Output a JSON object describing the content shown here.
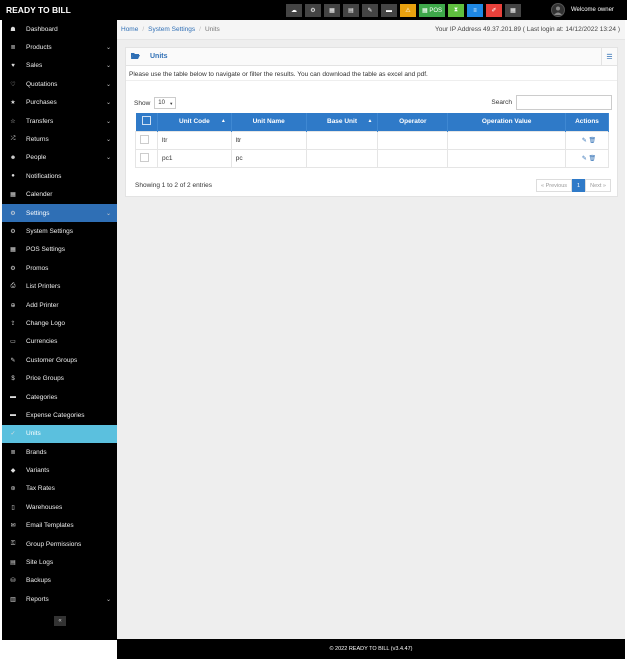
{
  "app": {
    "brand": "READY TO BILL"
  },
  "topbar": {
    "icons": [
      {
        "name": "dashboard-icon",
        "glyph": "☁",
        "style": ""
      },
      {
        "name": "settings-icon",
        "glyph": "⚙",
        "style": ""
      },
      {
        "name": "calculator-icon",
        "glyph": "▦",
        "style": ""
      },
      {
        "name": "calendar-icon",
        "glyph": "▤",
        "style": ""
      },
      {
        "name": "notes-icon",
        "glyph": "✎",
        "style": ""
      },
      {
        "name": "language-flag-icon",
        "glyph": "▬",
        "style": ""
      },
      {
        "name": "alert-icon",
        "glyph": "⚠",
        "style": "orange"
      },
      {
        "name": "pos-button",
        "glyph": "▦ POS",
        "style": "green"
      },
      {
        "name": "hourglass-icon",
        "glyph": "⧗",
        "style": "green2"
      },
      {
        "name": "list-icon",
        "glyph": "≡",
        "style": "blue"
      },
      {
        "name": "pen-icon",
        "glyph": "✐",
        "style": "red"
      },
      {
        "name": "grid-icon",
        "glyph": "▦",
        "style": ""
      }
    ],
    "welcome": "Welcome owner"
  },
  "sidebar": {
    "items": [
      {
        "label": "Dashboard",
        "icon": "☗",
        "name": "dashboard",
        "chev": false,
        "state": ""
      },
      {
        "label": "Products",
        "icon": "≣",
        "name": "products",
        "chev": true,
        "state": ""
      },
      {
        "label": "Sales",
        "icon": "♥",
        "name": "sales",
        "chev": true,
        "state": ""
      },
      {
        "label": "Quotations",
        "icon": "♡",
        "name": "quotations",
        "chev": true,
        "state": ""
      },
      {
        "label": "Purchases",
        "icon": "★",
        "name": "purchases",
        "chev": true,
        "state": ""
      },
      {
        "label": "Transfers",
        "icon": "☆",
        "name": "transfers",
        "chev": true,
        "state": ""
      },
      {
        "label": "Returns",
        "icon": "⤮",
        "name": "returns",
        "chev": true,
        "state": ""
      },
      {
        "label": "People",
        "icon": "☻",
        "name": "people",
        "chev": true,
        "state": ""
      },
      {
        "label": "Notifications",
        "icon": "●",
        "name": "notifications",
        "chev": false,
        "state": ""
      },
      {
        "label": "Calender",
        "icon": "▦",
        "name": "calender",
        "chev": false,
        "state": ""
      },
      {
        "label": "Settings",
        "icon": "⚙",
        "name": "settings",
        "chev": true,
        "state": "active"
      },
      {
        "label": "System Settings",
        "icon": "⚙",
        "name": "system-settings",
        "chev": false,
        "state": ""
      },
      {
        "label": "POS Settings",
        "icon": "▦",
        "name": "pos-settings",
        "chev": false,
        "state": ""
      },
      {
        "label": "Promos",
        "icon": "⚙",
        "name": "promos",
        "chev": false,
        "state": ""
      },
      {
        "label": "List Printers",
        "icon": "⎙",
        "name": "list-printers",
        "chev": false,
        "state": ""
      },
      {
        "label": "Add Printer",
        "icon": "⊕",
        "name": "add-printer",
        "chev": false,
        "state": ""
      },
      {
        "label": "Change Logo",
        "icon": "⇪",
        "name": "change-logo",
        "chev": false,
        "state": ""
      },
      {
        "label": "Currencies",
        "icon": "▭",
        "name": "currencies",
        "chev": false,
        "state": ""
      },
      {
        "label": "Customer Groups",
        "icon": "✎",
        "name": "customer-groups",
        "chev": false,
        "state": ""
      },
      {
        "label": "Price Groups",
        "icon": "$",
        "name": "price-groups",
        "chev": false,
        "state": ""
      },
      {
        "label": "Categories",
        "icon": "▬",
        "name": "categories",
        "chev": false,
        "state": ""
      },
      {
        "label": "Expense Categories",
        "icon": "▬",
        "name": "expense-categories",
        "chev": false,
        "state": ""
      },
      {
        "label": "Units",
        "icon": "✓",
        "name": "units",
        "chev": false,
        "state": "current"
      },
      {
        "label": "Brands",
        "icon": "≣",
        "name": "brands",
        "chev": false,
        "state": ""
      },
      {
        "label": "Variants",
        "icon": "◆",
        "name": "variants",
        "chev": false,
        "state": ""
      },
      {
        "label": "Tax Rates",
        "icon": "⊛",
        "name": "tax-rates",
        "chev": false,
        "state": ""
      },
      {
        "label": "Warehouses",
        "icon": "▯",
        "name": "warehouses",
        "chev": false,
        "state": ""
      },
      {
        "label": "Email Templates",
        "icon": "✉",
        "name": "email-templates",
        "chev": false,
        "state": ""
      },
      {
        "label": "Group Permissions",
        "icon": "⚿",
        "name": "group-permissions",
        "chev": false,
        "state": ""
      },
      {
        "label": "Site Logs",
        "icon": "▤",
        "name": "site-logs",
        "chev": false,
        "state": ""
      },
      {
        "label": "Backups",
        "icon": "⛁",
        "name": "backups",
        "chev": false,
        "state": ""
      },
      {
        "label": "Reports",
        "icon": "▥",
        "name": "reports",
        "chev": true,
        "state": ""
      }
    ],
    "collapse_glyph": "«"
  },
  "breadcrumb": {
    "items": [
      "Home",
      "System Settings",
      "Units"
    ],
    "ipinfo": "Your IP Address 49.37.201.89 ( Last login at: 14/12/2022 13:24 )"
  },
  "box": {
    "title": "Units",
    "intro": "Please use the table below to navigate or filter the results. You can download the table as excel and pdf.",
    "show_label": "Show",
    "show_value": "10",
    "search_label": "Search",
    "columns": [
      "Unit Code",
      "Unit Name",
      "Base Unit",
      "Operator",
      "Operation Value",
      "Actions"
    ],
    "rows": [
      [
        "ltr",
        "ltr",
        "",
        "",
        ""
      ],
      [
        "pc1",
        "pc",
        "",
        "",
        ""
      ]
    ],
    "entries": "Showing 1 to 2 of 2 entries",
    "pager": {
      "prev": "« Previous",
      "page": "1",
      "next": "Next »"
    }
  },
  "footer": {
    "text": "© 2022 READY TO BILL (v3.4.47)"
  }
}
